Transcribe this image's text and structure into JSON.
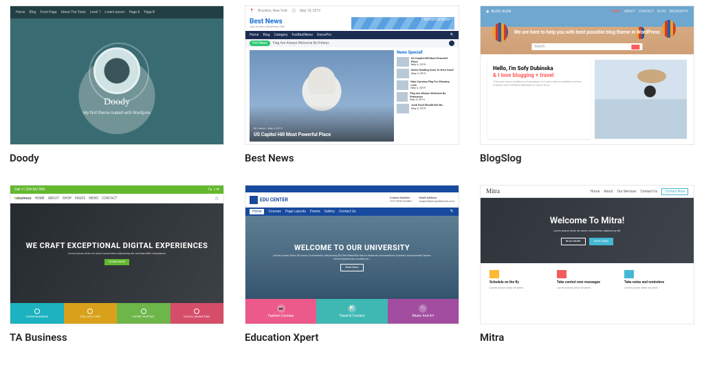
{
  "themes": [
    {
      "id": "doody",
      "title": "Doody",
      "preview": {
        "nav": [
          "Home",
          "Blog",
          "Front Page",
          "About The Tests",
          "Level 1",
          "Lorem ipsum",
          "Page A",
          "Page B"
        ],
        "hero_title": "Doody",
        "hero_sub": "My first theme maked with Wordpres"
      }
    },
    {
      "id": "bestnews",
      "title": "Best News",
      "preview": {
        "topbar_left": "Brooklyn, New York",
        "topbar_right": "May 18, 2019",
        "brand": "Best News",
        "brand_sub": "Just Another WordPress Site",
        "ad_label": "* ADVERTISEMENT *",
        "nav": [
          "Home",
          "Blog",
          "Category",
          "FoxBestNews",
          "DemoPro"
        ],
        "ticker_label": "Hot News",
        "ticker_text": "Flag Are Always Welcome By Enterpr.",
        "feature_meta": "By James · May 4, 2019",
        "feature_title": "US Capitol Hill Most Powerful Place",
        "sidebar_heading": "News Special!",
        "sidebar_items": [
          {
            "title": "US Capitol Hill Most Powerful Place",
            "date": "May 4, 2019"
          },
          {
            "title": "News Heading Goes To Here Good",
            "date": "May 4, 2019"
          },
          {
            "title": "Man Carrying Flag For Showing Love",
            "date": "May 4, 2019"
          },
          {
            "title": "Flag Are Always Welcome By Enterprise",
            "date": "May 4, 2019"
          },
          {
            "title": "Junk Food Should Not Be…",
            "date": "May 4, 2019"
          }
        ]
      }
    },
    {
      "id": "blogslog",
      "title": "BlogSlog",
      "preview": {
        "brand": "BLOG SLOG",
        "nav": [
          "HOME",
          "ABOUT",
          "CONTACT",
          "BLOG",
          "BIOGRAPHY"
        ],
        "hero": "We are here to help you with best possible blog theme in WordPress",
        "search_placeholder": "Search",
        "hello_h_black": "Hello, I'm Sofy Dubinska",
        "hello_h_red": "& I love blogging + travel",
        "hello_p": "There are many variations of passages of Lorem Ipsum available, but the majority have suffered alteration in some form."
      }
    },
    {
      "id": "tabusiness",
      "title": "TA Business",
      "preview": {
        "topbar_left": "Call +1 234 567 890",
        "brand_a": "ta",
        "brand_b": "business",
        "nav": [
          "HOME",
          "ABOUT",
          "SHOP",
          "PAGES",
          "NEWS",
          "CONTACT"
        ],
        "hero_h": "WE CRAFT EXCEPTIONAL DIGITAL EXPERIENCES",
        "hero_p": "Lorem ipsum dolor sit amet consectetur adipiscing elit sed blanditiis voluptatum",
        "sub_btn": "LEARN MORE",
        "tiles": [
          {
            "label": "LOREM BUSINESS",
            "color": "#1cb2c0"
          },
          {
            "label": "FEEL LIKE A PRO",
            "color": "#d9a11b"
          },
          {
            "label": "EXPERT SUPPORT",
            "color": "#6eb54a"
          },
          {
            "label": "DIGITAL MARKETING",
            "color": "#d64d6a"
          }
        ]
      }
    },
    {
      "id": "educationxpert",
      "title": "Education Xpert",
      "preview": {
        "brand": "EDU CENTER",
        "contact1_l": "Contact Number",
        "contact1_v": "+977-9851234567",
        "contact2_l": "Email Address",
        "contact2_v": "support@prosysthemes.com",
        "nav": [
          "Home",
          "Courses",
          "Page Layouts",
          "Events",
          "Gallery",
          "Contact Us"
        ],
        "hero_h": "WELCOME TO OUR UNIVERSITY",
        "hero_p": "Lorem Ipsum Dolor Sit Amet, Consectetur Adipiscing Elit Sed Blanditiis Nisl In Nostrum Accusantium Aperiam Assumenda Facere. Extra Repellendus Architecto…",
        "more": "Read More",
        "tiles": [
          {
            "label": "Fashion Courses",
            "color": "#ec5a8c"
          },
          {
            "label": "Travel & Tourism",
            "color": "#3fb8b3"
          },
          {
            "label": "Music And Art",
            "color": "#a24da0"
          }
        ]
      }
    },
    {
      "id": "mitra",
      "title": "Mitra",
      "preview": {
        "brand": "Mitra",
        "nav": [
          "Home",
          "About",
          "Our Services",
          "Contact Us"
        ],
        "cta": "Contact Now",
        "hero_h": "Welcome To Mitra!",
        "hero_p": "Lorem ipsum dolor sit amet, consectetur adipiscing elit.",
        "btn1": "READ MORE",
        "btn2": "VIEW DEMO",
        "features": [
          {
            "h": "Schedule on the fly",
            "p": "Lorem ipsum dolor sit amet."
          },
          {
            "h": "Take control over messages",
            "p": "Lorem ipsum dolor sit amet."
          },
          {
            "h": "Take notes and reminders",
            "p": "Lorem ipsum dolor sit amet."
          }
        ]
      }
    }
  ]
}
